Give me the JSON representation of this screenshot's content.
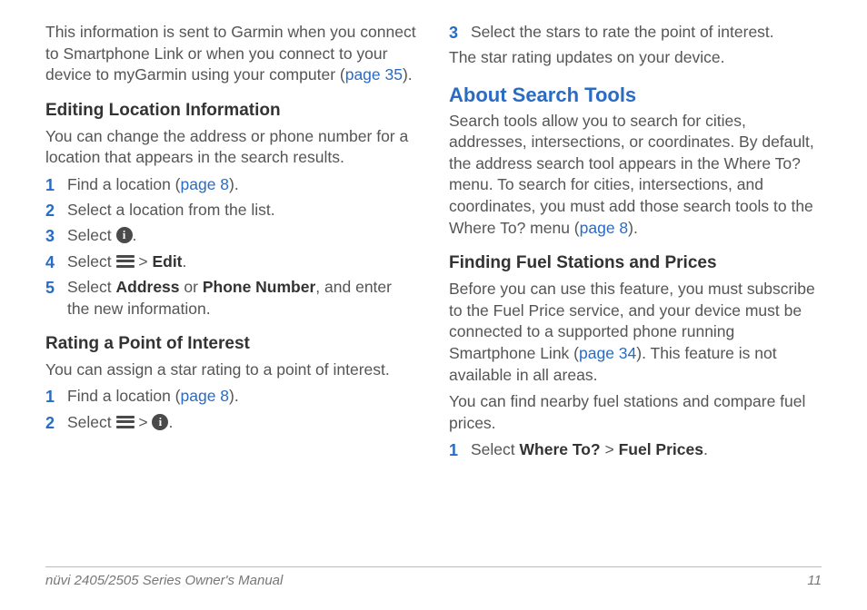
{
  "left": {
    "intro_a": "This information is sent to Garmin when you connect to Smartphone Link or when you connect to your device to myGarmin using your computer (",
    "intro_link": "page 35",
    "intro_b": ").",
    "h_editing": "Editing Location Information",
    "editing_intro": "You can change the address or phone number for a location that appears in the search results.",
    "edit_steps": {
      "s1a": "Find a location (",
      "s1link": "page 8",
      "s1b": ").",
      "s2": "Select a location from the list.",
      "s3a": "Select ",
      "s3b": ".",
      "s4a": "Select ",
      "s4gt": " > ",
      "s4bold": "Edit",
      "s4b": ".",
      "s5a": "Select ",
      "s5b1": "Address",
      "s5or": " or ",
      "s5b2": "Phone Number",
      "s5c": ", and enter the new information."
    },
    "h_rating": "Rating a Point of Interest",
    "rating_intro": "You can assign a star rating to a point of interest.",
    "rate_steps": {
      "s1a": "Find a location (",
      "s1link": "page 8",
      "s1b": ").",
      "s2a": "Select ",
      "s2gt": " > ",
      "s2b": "."
    }
  },
  "right": {
    "step3": "Select the stars to rate the point of interest.",
    "after3": "The star rating updates on your device.",
    "h_about": "About Search Tools",
    "about_a": "Search tools allow you to search for cities, addresses, intersections, or coordinates. By default, the address search tool appears in the Where To? menu. To search for cities, intersections, and coordinates, you must add those search tools to the Where To? menu (",
    "about_link": "page 8",
    "about_b": ").",
    "h_fuel": "Finding Fuel Stations and Prices",
    "fuel_a": "Before you can use this feature, you must subscribe to the Fuel Price service, and your device must be connected to a supported phone running Smartphone Link (",
    "fuel_link": "page 34",
    "fuel_b": "). This feature is not available in all areas.",
    "fuel2": "You can find nearby fuel stations and compare fuel prices.",
    "fuel_steps": {
      "s1a": "Select ",
      "s1b1": "Where To?",
      "s1gt": " > ",
      "s1b2": "Fuel Prices",
      "s1c": "."
    }
  },
  "footer": {
    "left": "nüvi 2405/2505 Series Owner's Manual",
    "right": "11"
  },
  "nums": {
    "n1": "1",
    "n2": "2",
    "n3": "3",
    "n4": "4",
    "n5": "5"
  }
}
